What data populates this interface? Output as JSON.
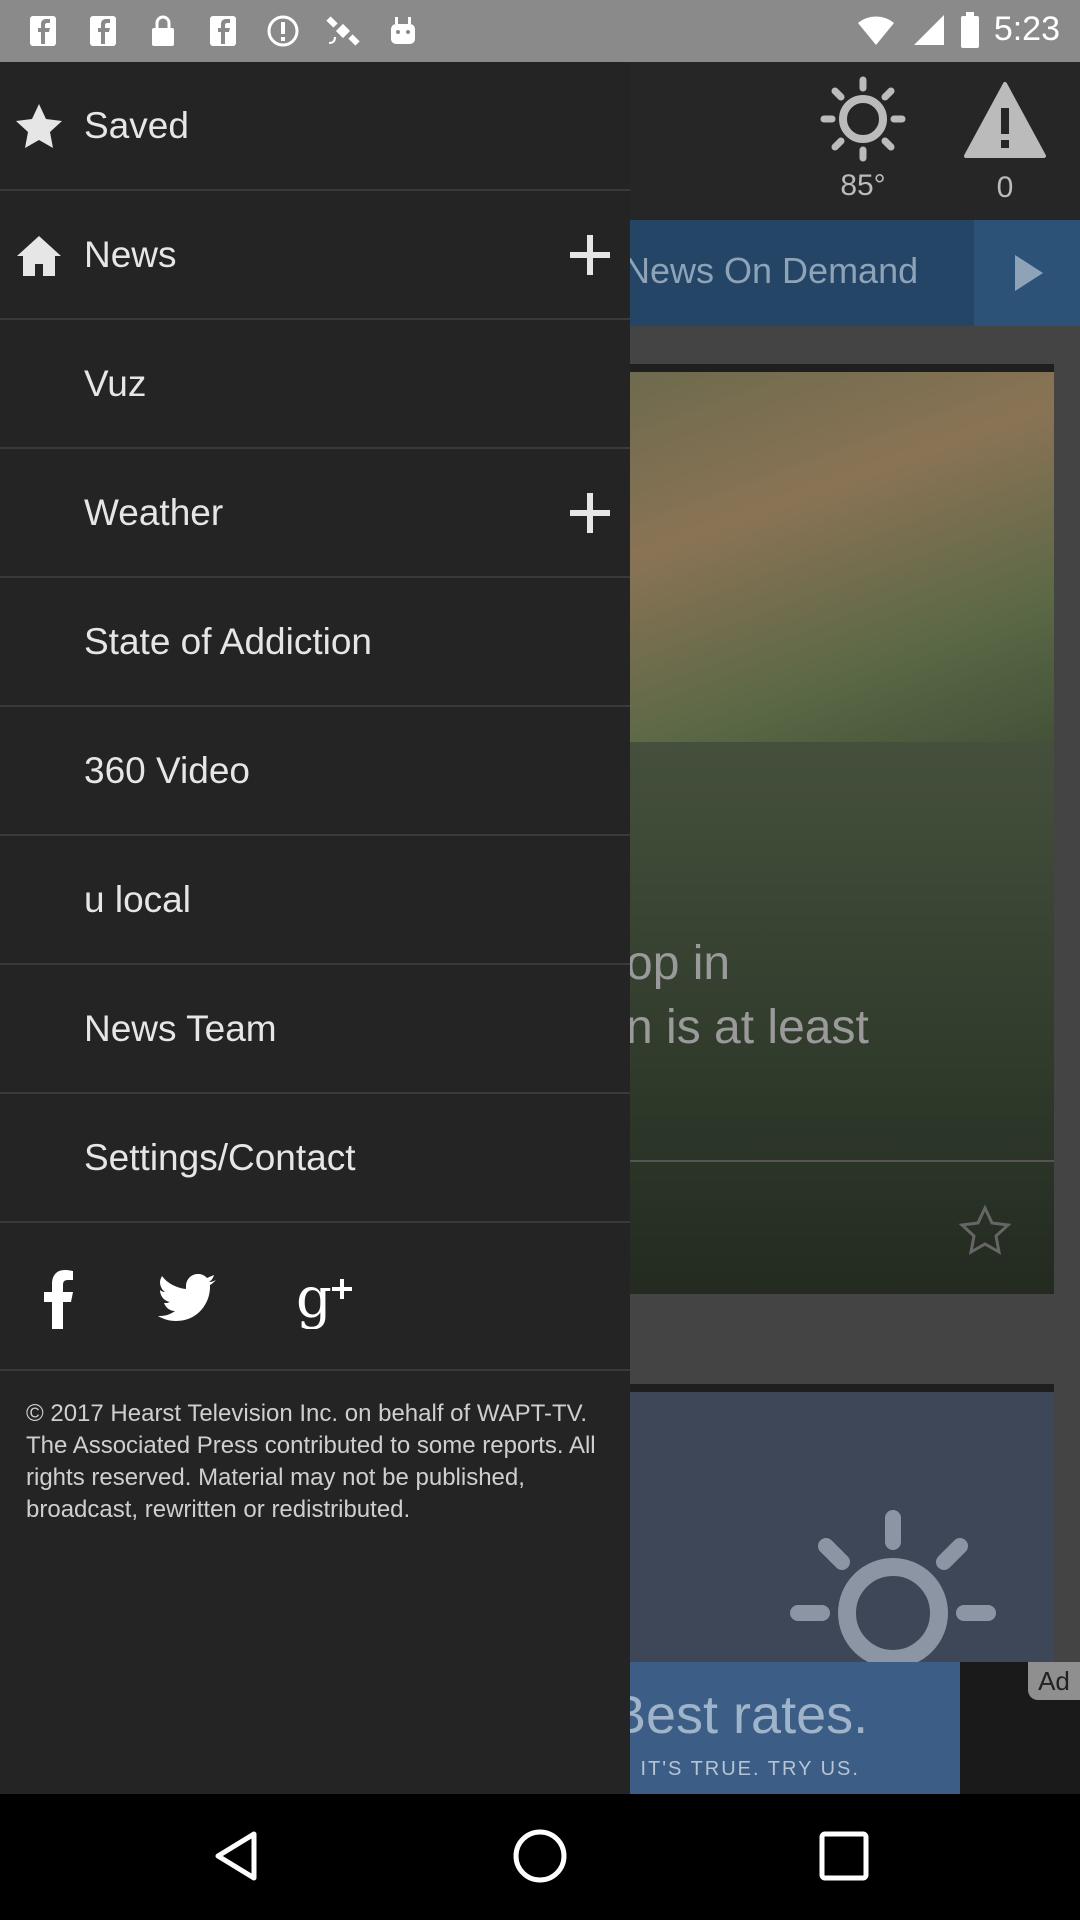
{
  "status_bar": {
    "time": "5:23",
    "left_icons": [
      "facebook-icon",
      "facebook-icon",
      "lock-icon",
      "facebook-icon",
      "info-icon",
      "satellite-icon",
      "android-icon"
    ]
  },
  "background": {
    "temperature": "85°",
    "alert_count": "0",
    "nod_label": "News On Demand",
    "story_fragment_line1": "op in",
    "story_fragment_line2": "n is at least",
    "ad_big_text": "Best rates.",
    "ad_small_text": "S. IT'S TRUE. TRY US.",
    "ad_tag": "Ad"
  },
  "drawer": {
    "items": [
      {
        "label": "Saved",
        "icon": "star-icon",
        "expandable": false
      },
      {
        "label": "News",
        "icon": "home-icon",
        "expandable": true
      },
      {
        "label": "Vuz",
        "icon": "",
        "expandable": false
      },
      {
        "label": "Weather",
        "icon": "",
        "expandable": true
      },
      {
        "label": "State of Addiction",
        "icon": "",
        "expandable": false
      },
      {
        "label": "360 Video",
        "icon": "",
        "expandable": false
      },
      {
        "label": "u local",
        "icon": "",
        "expandable": false
      },
      {
        "label": "News Team",
        "icon": "",
        "expandable": false
      },
      {
        "label": "Settings/Contact",
        "icon": "",
        "expandable": false
      }
    ],
    "social": [
      "facebook-icon",
      "twitter-icon",
      "google-plus-icon"
    ],
    "copyright": "© 2017 Hearst Television Inc. on behalf of WAPT-TV. The Associated Press contributed to some reports. All rights reserved. Material may not be published, broadcast, rewritten or redistributed."
  },
  "colors": {
    "drawer_bg": "#242424",
    "divider": "#3a3a3a",
    "nod_bar": "#244566",
    "status_bar": "#8a8a8a"
  }
}
